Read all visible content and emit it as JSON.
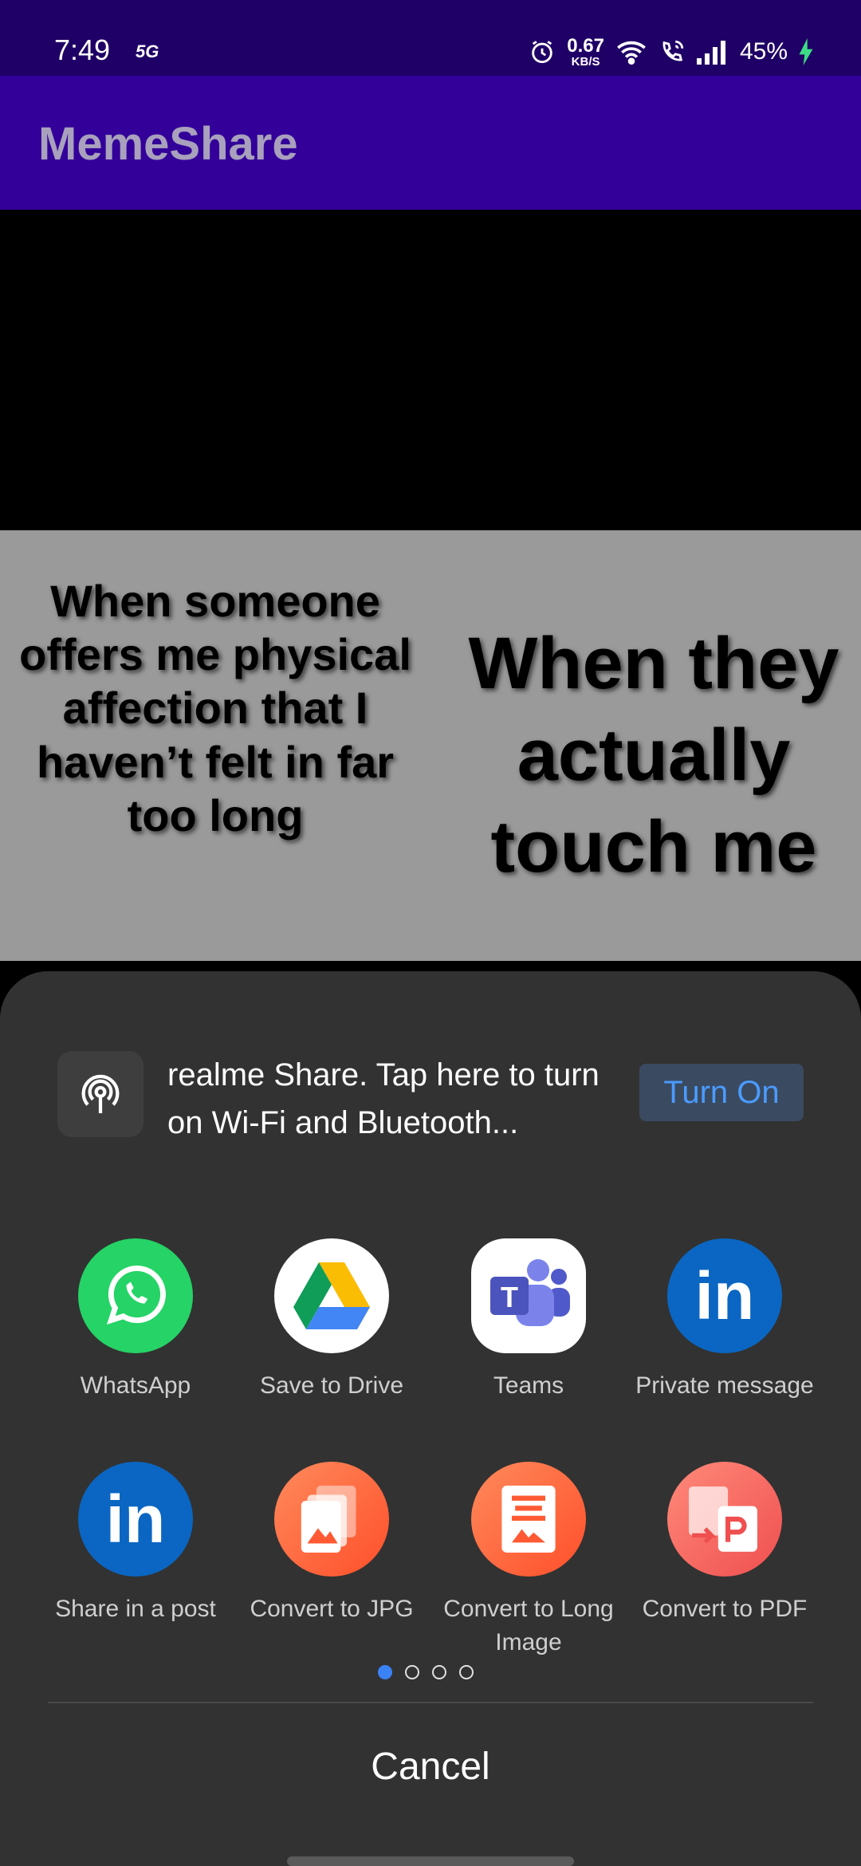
{
  "status_bar": {
    "time": "7:49",
    "network_type": "5G",
    "speed_value": "0.67",
    "speed_unit": "KB/S",
    "battery": "45%"
  },
  "app_bar": {
    "title": "MemeShare"
  },
  "meme": {
    "left_text": "When someone offers me physical affection that I haven’t felt in far too long",
    "right_text": "When they actually touch me"
  },
  "share_sheet": {
    "realme_share_text": "realme Share. Tap here to turn on Wi-Fi and Bluetooth...",
    "turn_on_label": "Turn On",
    "apps": [
      {
        "label": "WhatsApp",
        "icon": "whatsapp-icon",
        "color": "#25d366"
      },
      {
        "label": "Save to Drive",
        "icon": "google-drive-icon",
        "color": "#ffffff"
      },
      {
        "label": "Teams",
        "icon": "teams-icon",
        "color": "#ffffff"
      },
      {
        "label": "Private message",
        "icon": "linkedin-icon",
        "color": "#0a66c2"
      },
      {
        "label": "Share in a post",
        "icon": "linkedin-icon",
        "color": "#0a66c2"
      },
      {
        "label": "Convert to JPG",
        "icon": "image-convert-icon",
        "color": "#ff6a3d"
      },
      {
        "label": "Convert to Long Image",
        "icon": "long-image-icon",
        "color": "#ff6a3d"
      },
      {
        "label": "Convert to PDF",
        "icon": "pdf-convert-icon",
        "color": "#f05a5a"
      }
    ],
    "page_indicator": {
      "pages": 4,
      "active": 1
    },
    "cancel_label": "Cancel"
  }
}
